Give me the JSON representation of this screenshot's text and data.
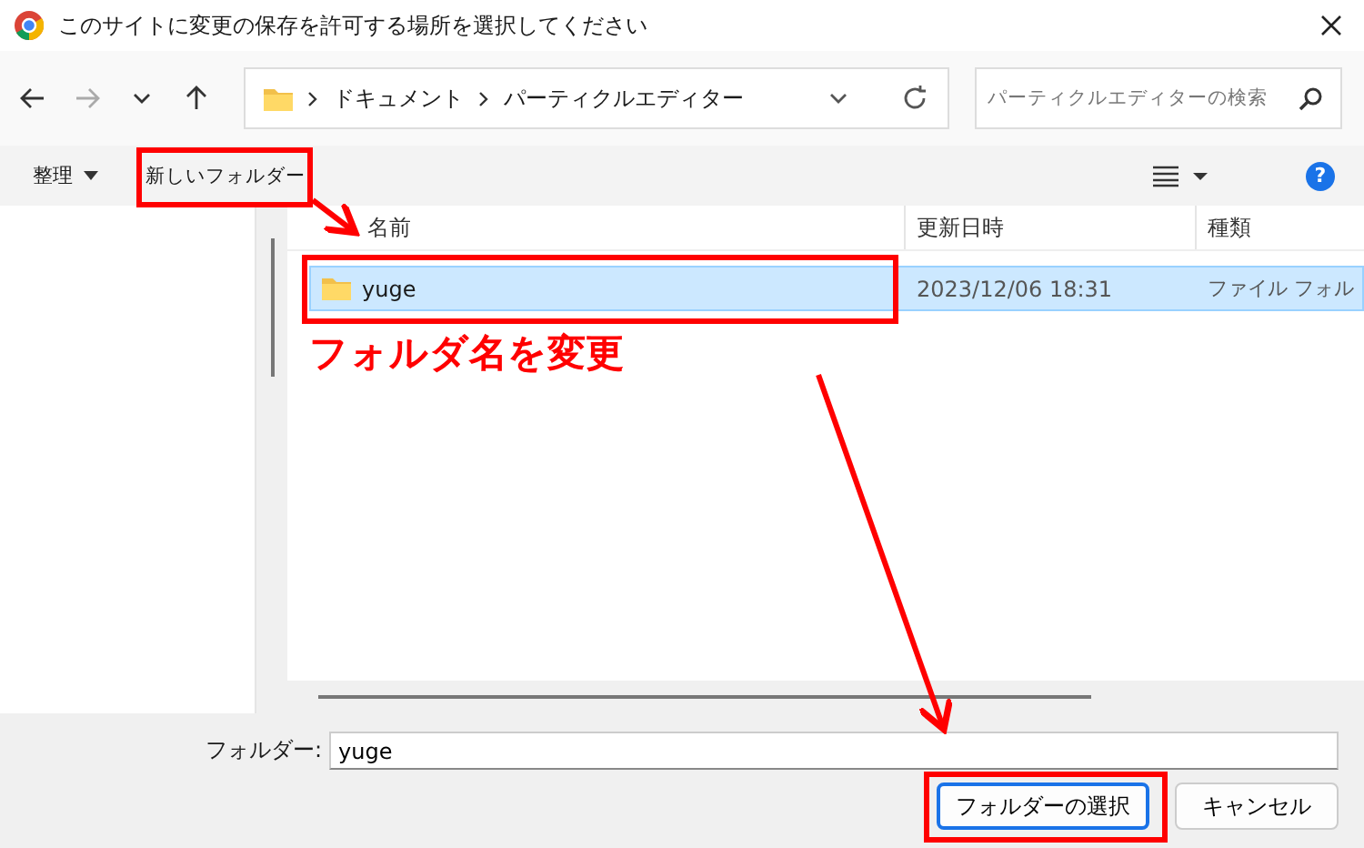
{
  "window": {
    "title": "このサイトに変更の保存を許可する場所を選択してください"
  },
  "navigation": {
    "path": [
      "ドキュメント",
      "パーティクルエディター"
    ],
    "search": {
      "placeholder": "パーティクルエディターの検索"
    }
  },
  "toolbar": {
    "organize": "整理",
    "new_folder": "新しいフォルダー",
    "help": "?"
  },
  "file_list": {
    "columns": [
      "名前",
      "更新日時",
      "種類"
    ],
    "rows": [
      {
        "name": "yuge",
        "modified": "2023/12/06 18:31",
        "type": "ファイル フォル",
        "selected": true
      }
    ]
  },
  "footer": {
    "folder_label": "フォルダー:",
    "folder_value": "yuge",
    "buttons": [
      {
        "label": "フォルダーの選択",
        "kind": "primary"
      },
      {
        "label": "キャンセル",
        "kind": "secondary"
      }
    ]
  },
  "annotation": {
    "caption": "フォルダ名を変更"
  }
}
